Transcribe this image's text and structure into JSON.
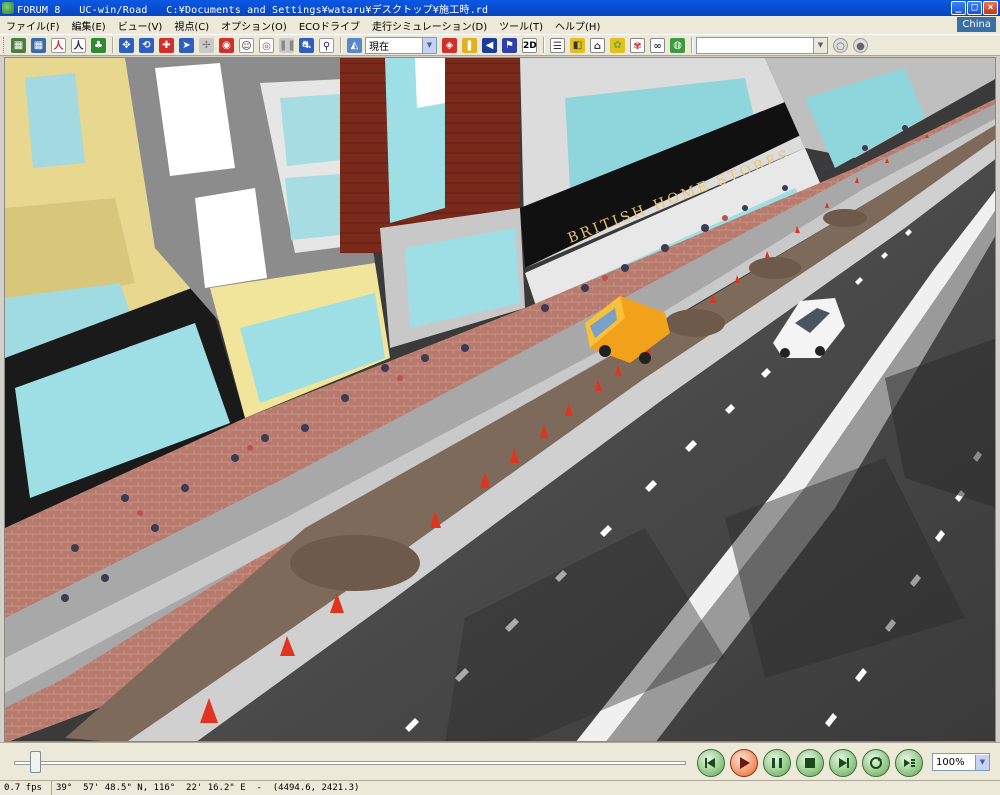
{
  "titlebar": {
    "title": "FORUM 8   UC-win/Road   C:¥Documents and Settings¥wataru¥デスクトップ¥施工時.rd"
  },
  "menubar": {
    "items": [
      "ファイル(F)",
      "編集(E)",
      "ビュー(V)",
      "視点(C)",
      "オプション(O)",
      "ECOドライブ",
      "走行シミュレーション(D)",
      "ツール(T)",
      "ヘルプ(H)"
    ],
    "locale": "China"
  },
  "toolbar": {
    "viewpoint_combo": "現在",
    "mode_2d": "2D",
    "search_combo": ""
  },
  "viewport": {
    "store_sign": "BRITISH HOME STORES"
  },
  "playback": {
    "zoom": "100%"
  },
  "status": {
    "fps": "0.7 fps",
    "coordinates": "39°  57' 48.5\" N, 116°  22' 16.2\" E  -  (4494.6, 2421.3)"
  }
}
